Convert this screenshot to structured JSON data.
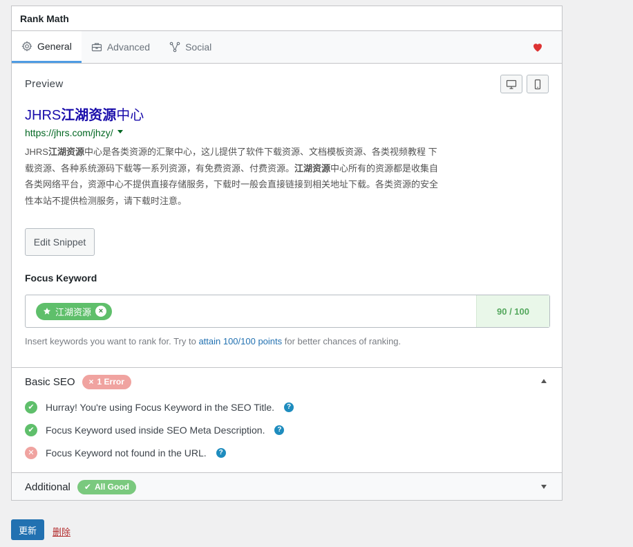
{
  "panel": {
    "title": "Rank Math"
  },
  "tabs": [
    {
      "label": "General",
      "icon": "gear-icon",
      "active": true
    },
    {
      "label": "Advanced",
      "icon": "toolbox-icon",
      "active": false
    },
    {
      "label": "Social",
      "icon": "share-network-icon",
      "active": false
    }
  ],
  "preview": {
    "label": "Preview",
    "title_pre": "JHRS",
    "title_bold": "江湖资源",
    "title_post": "中心",
    "url": "https://jhrs.com/jhzy/",
    "desc_1": "JHRS",
    "desc_2": "江湖资源",
    "desc_3": "中心是各类资源的汇聚中心，这儿提供了软件下载资源、文档模板资源、各类视频教程 下载资源、各种系统源码下载等一系列资源，有免费资源、付费资源。",
    "desc_4": "江湖资源",
    "desc_5": "中心所有的资源都是收集自各类网络平台，资源中心不提供直接存储服务，下载时一般会直接链接到相关地址下载。各类资源的安全性本站不提供检测服务，请下载时注意。",
    "edit_label": "Edit Snippet"
  },
  "focus_keyword": {
    "label": "Focus Keyword",
    "tag": "江湖资源",
    "remove": "×",
    "score": "90 / 100",
    "help_pre": "Insert keywords you want to rank for. Try to ",
    "help_link": "attain 100/100 points",
    "help_post": " for better chances of ranking."
  },
  "basic_seo": {
    "title": "Basic SEO",
    "badge": "1 Error",
    "badge_icon": "×",
    "items": [
      {
        "text": "Hurray! You're using Focus Keyword in the SEO Title.",
        "status": "ok"
      },
      {
        "text": "Focus Keyword used inside SEO Meta Description.",
        "status": "ok"
      },
      {
        "text": "Focus Keyword not found in the URL.",
        "status": "bad"
      }
    ],
    "ok_glyph": "✔",
    "bad_glyph": "✕",
    "help_glyph": "?"
  },
  "additional": {
    "title": "Additional",
    "badge": "All Good",
    "badge_icon": "✔"
  },
  "footer": {
    "update": "更新",
    "delete": "删除"
  },
  "colors": {
    "accent": "#4e9ce3",
    "good": "#5fbf6b",
    "error": "#f0a3a0",
    "link": "#2271b1",
    "heart": "#dd3333"
  }
}
